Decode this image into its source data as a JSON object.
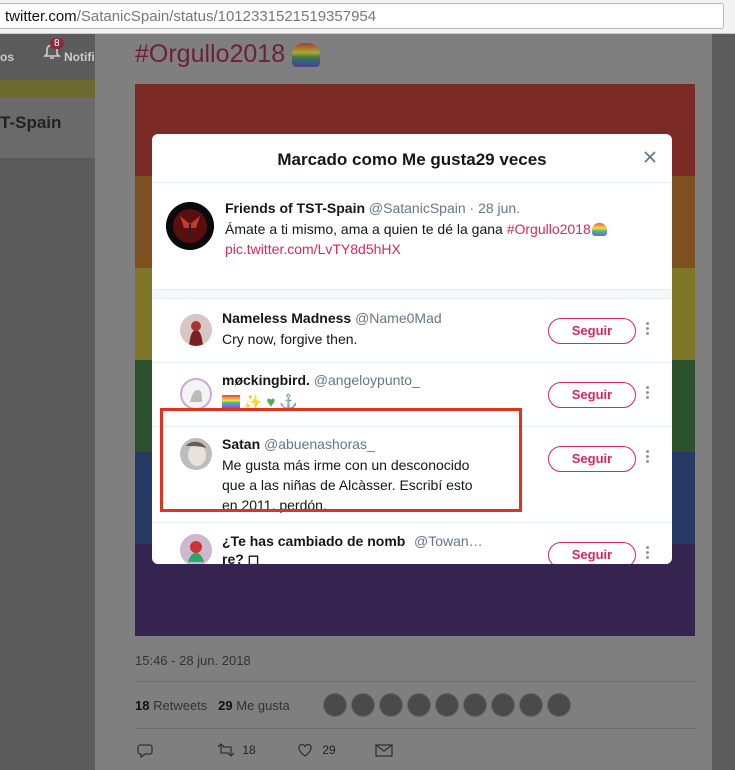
{
  "browser": {
    "url_host": "twitter.com",
    "url_path": "/SatanicSpain/status/1012331521519357954"
  },
  "background": {
    "nav_text": "os",
    "notif_label": "Notifi",
    "notif_count": "8",
    "profile_name": "T-Spain",
    "hashtag": "#Orgullo2018",
    "timestamp": "15:46 - 28 jun. 2018",
    "retweets_count": "18",
    "retweets_label": "Retweets",
    "likes_count": "29",
    "likes_label": "Me gusta",
    "action_retweet_count": "18",
    "action_like_count": "29",
    "rainbow_colors": [
      "#a8382f",
      "#a36a2a",
      "#a89c37",
      "#3b6f3c",
      "#334f86",
      "#48306b"
    ]
  },
  "modal": {
    "title": "Marcado como Me gusta29 veces",
    "original_tweet": {
      "name": "Friends of TST-Spain",
      "handle": "@SatanicSpain",
      "date": " · 28 jun.",
      "text": "Ámate a ti mismo, ama a quien te dé la gana ",
      "hashtag": "#Orgullo2018",
      "link": "pic.twitter.com/LvTY8d5hHX"
    },
    "users": [
      {
        "name": "Nameless Madness",
        "handle": "@Name0Mad",
        "bio": "Cry now, forgive then.",
        "button": "Seguir"
      },
      {
        "name": "møckingbird.",
        "handle": "@angeloypunto_",
        "bio": "",
        "button": "Seguir"
      },
      {
        "name": "Satan",
        "handle": "@abuenashoras_",
        "bio": "Me gusta más irme con un desconocido que a las niñas de Alcàsser. Escribí esto en 2011, perdón.",
        "button": "Seguir"
      },
      {
        "name": "¿Te has cambiado de nomb re? ◻",
        "handle": "@Towan…",
        "bio": "",
        "button": "Seguir"
      }
    ]
  },
  "colors": {
    "accent": "#e0245e",
    "highlight_box": "#e0321c",
    "muted": "#657786"
  }
}
